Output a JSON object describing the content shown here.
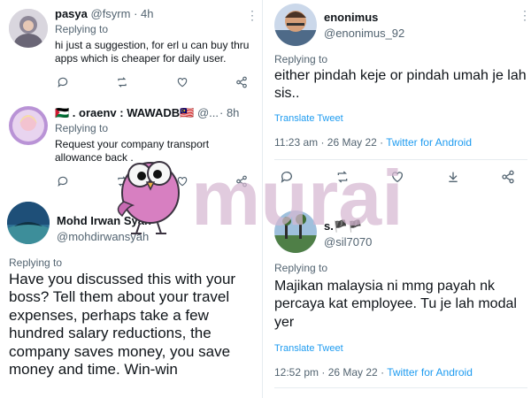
{
  "colors": {
    "accent": "#1d9bf0",
    "muted": "#536471",
    "watermark": "#d6b7d1"
  },
  "tweets": [
    {
      "display_name": "pasya",
      "handle": "@fsyrm",
      "time": "· 4h",
      "replying_to": "Replying to",
      "text": "hi just a suggestion, for erl u can buy thru apps which is cheaper for daily user."
    },
    {
      "display_name": "🇵🇸 . oraenv : WAWADB🇲🇾",
      "handle": "@...",
      "time": "· 8h",
      "replying_to": "Replying to",
      "text": "Request your company transport allowance back ."
    },
    {
      "display_name": "Mohd Irwan Syah",
      "handle": "@mohdirwansyah",
      "replying_to": "Replying to",
      "text": "Have you discussed this with your boss? Tell them about your travel expenses, perhaps take a few hundred salary reductions, the company saves money, you save money and time. Win-win"
    },
    {
      "display_name": "enonimus",
      "handle": "@enonimus_92",
      "replying_to": "Replying to",
      "text": "either pindah keje or pindah umah je lah sis..",
      "translate": "Translate Tweet",
      "timestamp": "11:23 am · 26 May 22 · ",
      "source": "Twitter for Android"
    },
    {
      "display_name": "s.🏴🏴",
      "handle": "@sil7070",
      "replying_to": "Replying to",
      "text": "Majikan malaysia ni mmg payah nk percaya kat employee. Tu je lah modal yer",
      "translate": "Translate Tweet",
      "timestamp": "12:52 pm · 26 May 22 · ",
      "source": "Twitter for Android"
    }
  ],
  "icons": [
    "reply-icon",
    "retweet-icon",
    "like-icon",
    "analytics-icon",
    "share-icon",
    "more-icon"
  ],
  "watermark": {
    "text": "murai"
  }
}
